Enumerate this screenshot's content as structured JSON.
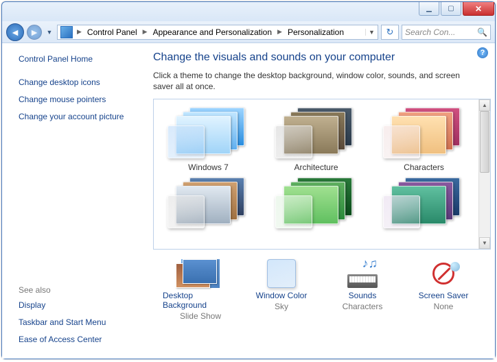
{
  "breadcrumb": {
    "root": "Control Panel",
    "mid": "Appearance and Personalization",
    "leaf": "Personalization"
  },
  "search": {
    "placeholder": "Search Con..."
  },
  "sidebar": {
    "home": "Control Panel Home",
    "links": [
      "Change desktop icons",
      "Change mouse pointers",
      "Change your account picture"
    ],
    "seealso_head": "See also",
    "seealso": [
      "Display",
      "Taskbar and Start Menu",
      "Ease of Access Center"
    ]
  },
  "main": {
    "title": "Change the visuals and sounds on your computer",
    "desc": "Click a theme to change the desktop background, window color, sounds, and screen saver all at once."
  },
  "themes": [
    {
      "label": "Windows 7",
      "cls": "g-win7"
    },
    {
      "label": "Architecture",
      "cls": "g-arch"
    },
    {
      "label": "Characters",
      "cls": "g-char"
    },
    {
      "label": "",
      "cls": "g-land"
    },
    {
      "label": "",
      "cls": "g-nat"
    },
    {
      "label": "",
      "cls": "g-scn"
    }
  ],
  "options": {
    "desktop": {
      "label": "Desktop Background",
      "val": "Slide Show"
    },
    "color": {
      "label": "Window Color",
      "val": "Sky"
    },
    "sounds": {
      "label": "Sounds",
      "val": "Characters"
    },
    "saver": {
      "label": "Screen Saver",
      "val": "None"
    }
  }
}
